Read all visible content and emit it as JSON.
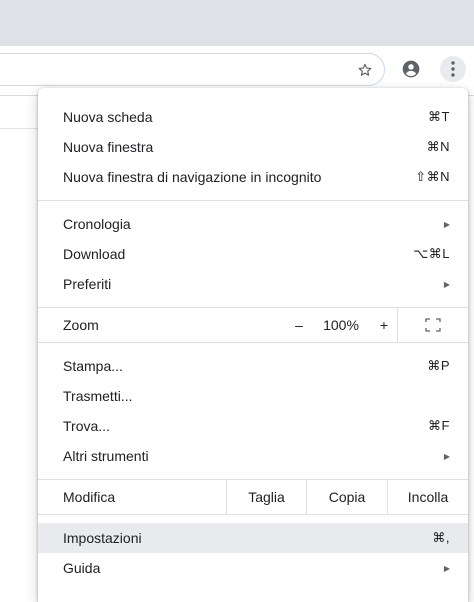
{
  "toolbar": {
    "star_icon": "star-outline-icon",
    "profile_icon": "account-circle-icon",
    "menu_icon": "kebab-menu-icon"
  },
  "menu": {
    "group1": [
      {
        "label": "Nuova scheda",
        "shortcut": "⌘T"
      },
      {
        "label": "Nuova finestra",
        "shortcut": "⌘N"
      },
      {
        "label": "Nuova finestra di navigazione in incognito",
        "shortcut": "⇧⌘N"
      }
    ],
    "group2": [
      {
        "label": "Cronologia",
        "shortcut": "▶"
      },
      {
        "label": "Download",
        "shortcut": "⌥⌘L"
      },
      {
        "label": "Preferiti",
        "shortcut": "▶"
      }
    ],
    "zoom": {
      "label": "Zoom",
      "minus": "–",
      "value": "100%",
      "plus": "+"
    },
    "group3": [
      {
        "label": "Stampa...",
        "shortcut": "⌘P"
      },
      {
        "label": "Trasmetti...",
        "shortcut": ""
      },
      {
        "label": "Trova...",
        "shortcut": "⌘F"
      },
      {
        "label": "Altri strumenti",
        "shortcut": "▶"
      }
    ],
    "edit": {
      "label": "Modifica",
      "cut": "Taglia",
      "copy": "Copia",
      "paste": "Incolla"
    },
    "group4": [
      {
        "label": "Impostazioni",
        "shortcut": "⌘,"
      },
      {
        "label": "Guida",
        "shortcut": "▶"
      }
    ]
  },
  "colors": {
    "highlight": "#e8eaed",
    "tabstrip": "#dee1e6",
    "text": "#202124"
  }
}
